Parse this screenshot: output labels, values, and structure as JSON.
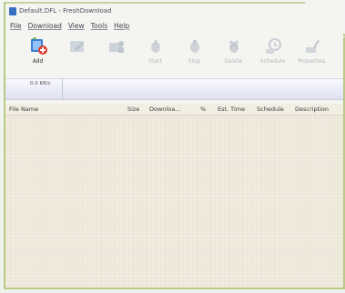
{
  "window": {
    "title": "Default.DFL - FreshDownload"
  },
  "menu": {
    "items": [
      "File",
      "Download",
      "View",
      "Tools",
      "Help"
    ]
  },
  "toolbar": {
    "buttons": [
      {
        "label": "Add",
        "icon": "add-download-icon"
      },
      {
        "label": "",
        "icon": "edit-icon"
      },
      {
        "label": "",
        "icon": "folder-user-icon"
      },
      {
        "label": "Start",
        "icon": "start-icon"
      },
      {
        "label": "Stop",
        "icon": "stop-icon"
      },
      {
        "label": "Delete",
        "icon": "delete-icon"
      },
      {
        "label": "Schedule",
        "icon": "schedule-icon"
      },
      {
        "label": "Properties",
        "icon": "properties-icon"
      }
    ]
  },
  "status": {
    "speed": "0.0 KB/s"
  },
  "table": {
    "columns": [
      "File Name",
      "Size",
      "Downloa...",
      "%",
      "Est. Time",
      "Schedule",
      "Description"
    ]
  },
  "colors": {
    "outline": "#b8c98a",
    "list_background": "#efe9dc",
    "accent": "#3a6ec4"
  }
}
